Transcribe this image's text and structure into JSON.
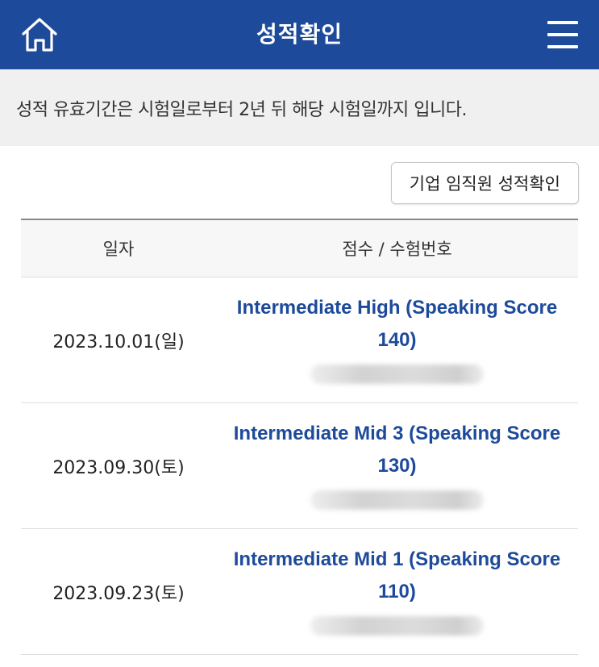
{
  "header": {
    "title": "성적확인",
    "home_icon": "home-icon",
    "menu_icon": "hamburger-menu-icon",
    "brand_color": "#1d4a9a"
  },
  "notice": {
    "text": "성적 유효기간은 시험일로부터 2년 뒤 해당 시험일까지 입니다."
  },
  "corp_button": {
    "label": "기업 임직원 성적확인"
  },
  "table": {
    "headers": {
      "date": "일자",
      "score": "점수 / 수험번호"
    },
    "rows": [
      {
        "date": "2023.10.01(일)",
        "score": "Intermediate High (Speaking Score 140)"
      },
      {
        "date": "2023.09.30(토)",
        "score": "Intermediate Mid 3 (Speaking Score 130)"
      },
      {
        "date": "2023.09.23(토)",
        "score": "Intermediate Mid 1 (Speaking Score 110)"
      }
    ]
  }
}
